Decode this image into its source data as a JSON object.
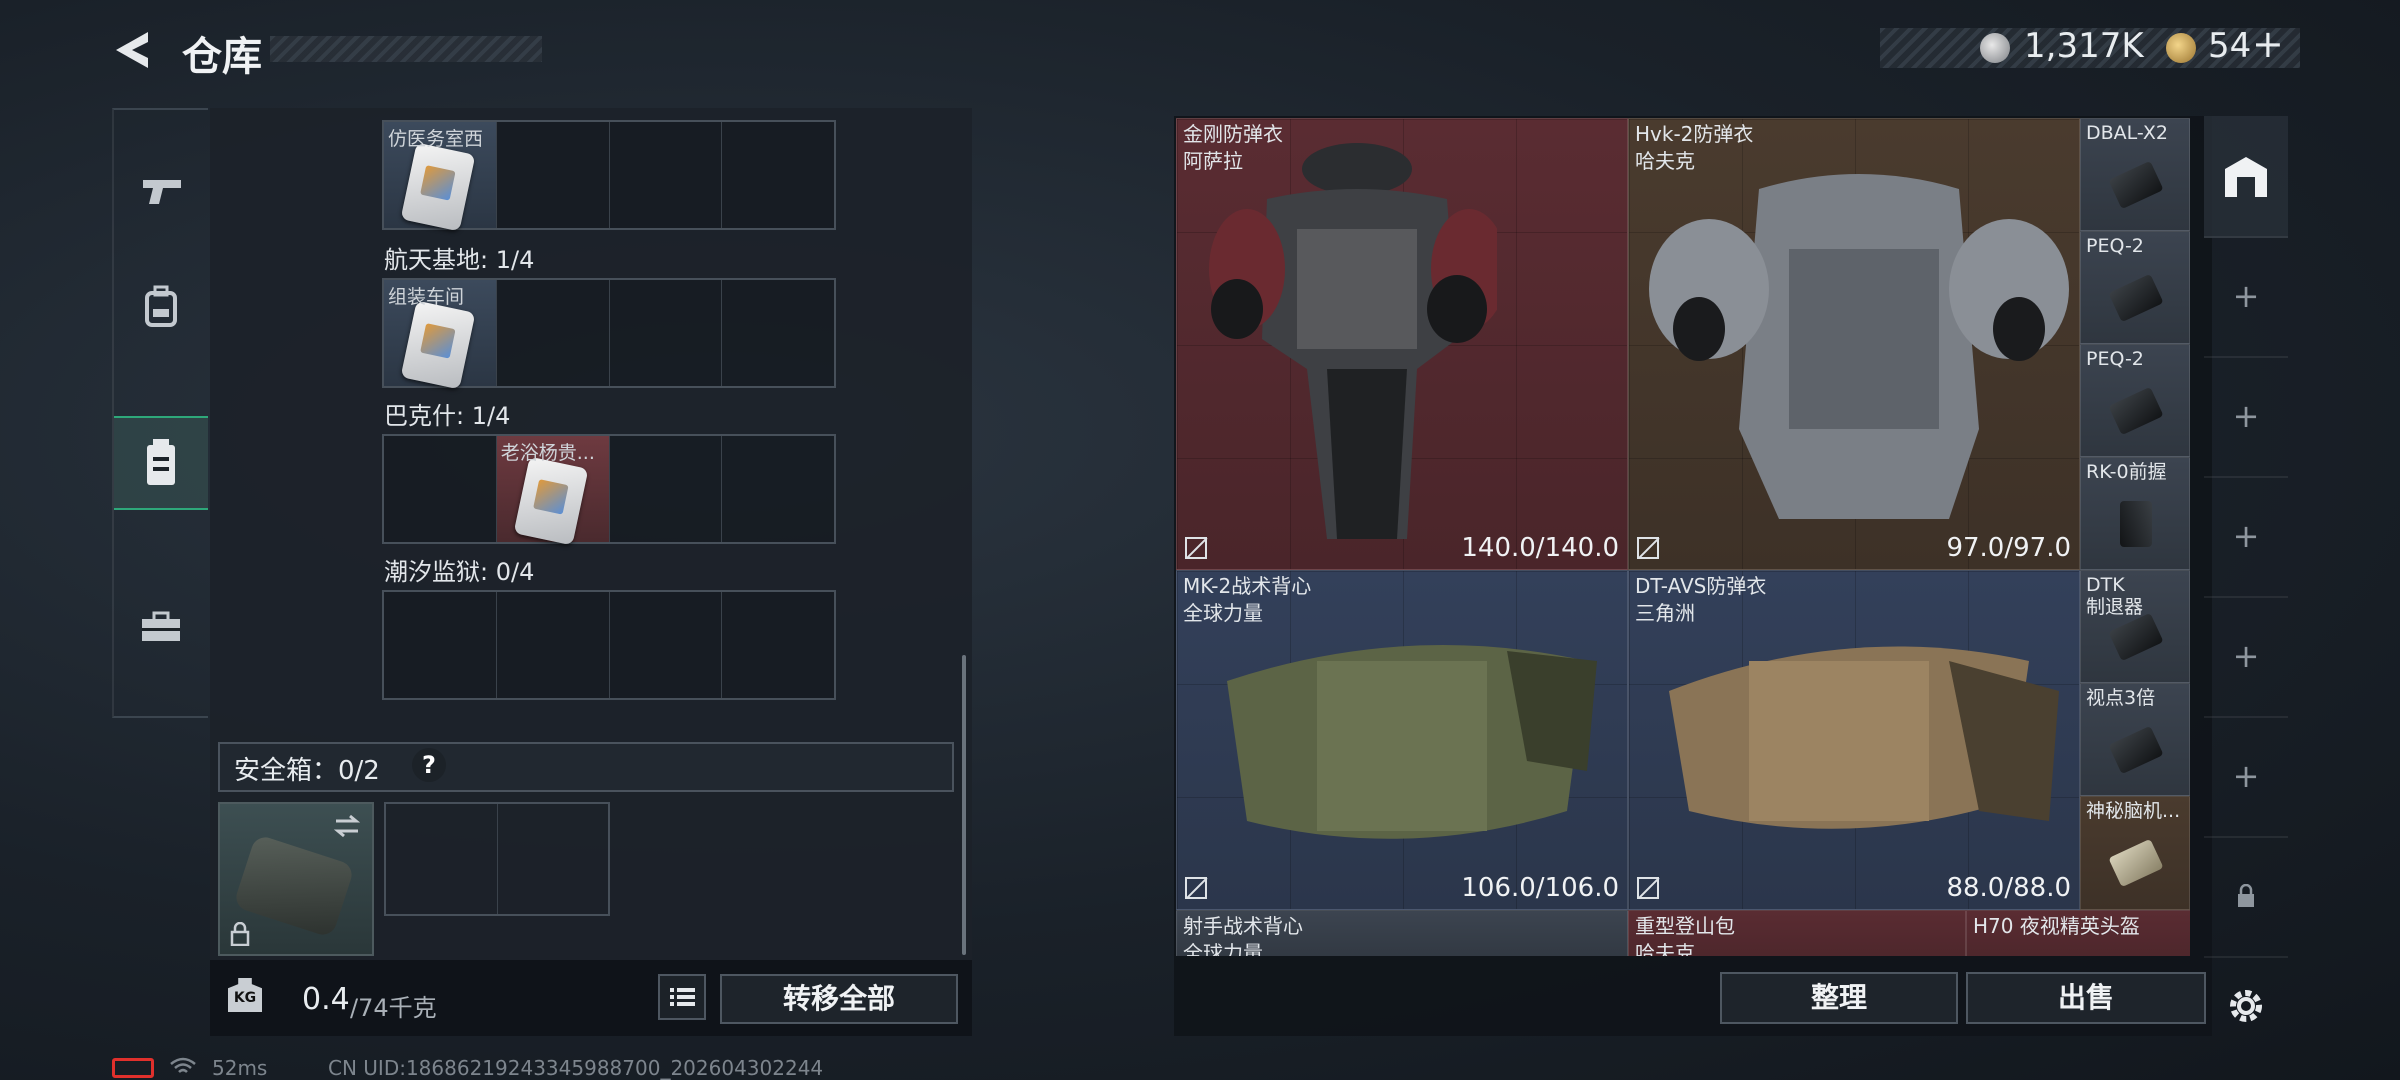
{
  "header": {
    "title": "仓库",
    "silver_amount": "1,317K",
    "gold_amount": "54",
    "add_symbol": "+"
  },
  "side_tabs": [
    {
      "name": "weapons-tab",
      "icon": "pistol-icon"
    },
    {
      "name": "equipment-tab",
      "icon": "backpack-icon"
    },
    {
      "name": "containers-tab",
      "icon": "canister-icon",
      "active": true
    },
    {
      "name": "keys-tab",
      "icon": "toolbox-icon"
    }
  ],
  "key_zones": {
    "row0_item": "仿医务室西",
    "zone1": "航天基地: 1/4",
    "row1_item": "组装车间",
    "zone2": "巴克什: 1/4",
    "row2_item": "老浴杨贵...",
    "zone3": "潮汐监狱: 0/4"
  },
  "safe_box": {
    "label": "安全箱：0/2",
    "help": "?"
  },
  "weight": {
    "current": "0.4",
    "max": "/74千克",
    "kg_label": "KG"
  },
  "transfer_all": "转移全部",
  "stash": {
    "items": [
      {
        "name": "金刚防弹衣",
        "brand": "阿萨拉",
        "durability": "140.0/140.0",
        "tone": "red"
      },
      {
        "name": "Hvk-2防弹衣",
        "brand": "哈夫克",
        "durability": "97.0/97.0",
        "tone": "brown"
      },
      {
        "name": "MK-2战术背心",
        "brand": "全球力量",
        "durability": "106.0/106.0",
        "tone": "blue"
      },
      {
        "name": "DT-AVS防弹衣",
        "brand": "三角洲",
        "durability": "88.0/88.0",
        "tone": "blue"
      },
      {
        "name": "射手战术背心",
        "brand": "全球力量"
      },
      {
        "name": "重型登山包",
        "brand": "哈夫克"
      },
      {
        "name": "H70 夜视精英头盔"
      }
    ],
    "small_items": [
      "DBAL-X2",
      "PEQ-2",
      "PEQ-2",
      "RK-0前握",
      "DTK\n制退器",
      "视点3倍",
      "神秘脑机..."
    ]
  },
  "actions": {
    "sort": "整理",
    "sell": "出售"
  },
  "status": {
    "ping": "52ms",
    "uid": "CN UID:18686219243345988700_202604302244"
  },
  "colors": {
    "accent_green": "#2ea87a",
    "tile_red": "#5a2c32",
    "tile_brown": "#4a3b2e",
    "tile_blue": "#33405a"
  }
}
